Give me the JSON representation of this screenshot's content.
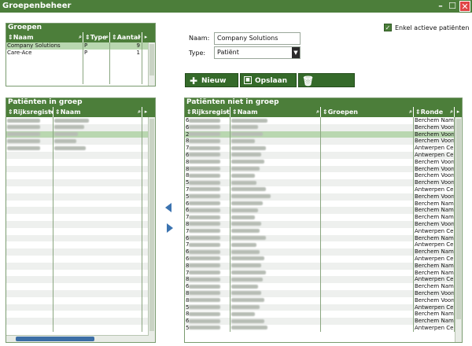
{
  "window": {
    "title": "Groepenbeheer",
    "min": "–",
    "max": "☐",
    "close": "✕"
  },
  "groups": {
    "title": "Groepen",
    "columns": [
      "Naam",
      "Type",
      "Aantal"
    ],
    "rows": [
      {
        "naam": "Company Solutions",
        "type": "P",
        "aantal": "9"
      },
      {
        "naam": "Care-Ace",
        "type": "P",
        "aantal": "1"
      }
    ]
  },
  "form": {
    "name_label": "Naam:",
    "name_value": "Company Solutions",
    "type_label": "Type:",
    "type_value": "Patiënt",
    "active_label": "Enkel actieve patiënten"
  },
  "toolbar": {
    "new_label": "Nieuw",
    "save_label": "Opslaan",
    "delete_label": "Verwijderen"
  },
  "in_group": {
    "title": "Patiënten in groep",
    "columns": [
      "Rijksregiste",
      "Naam"
    ],
    "selected_row": 2
  },
  "not_in_group": {
    "title": "Patiënten niet in groep",
    "columns": [
      "Rijksregiste",
      "Naam",
      "Groepen",
      "Ronde"
    ],
    "rondes": [
      "Berchem Nami",
      "Berchem Voorn",
      "Berchem Voorn",
      "Berchem Voorn",
      "Antwerpen Cer",
      "Antwerpen Cer",
      "Berchem Voorn",
      "Berchem Voorn",
      "Berchem Voorn",
      "Berchem Voorn",
      "Antwerpen Cer",
      "Berchem Voorn",
      "Berchem Nami",
      "Berchem Nami",
      "Berchem Nami",
      "Berchem Voorn",
      "Antwerpen Cer",
      "Berchem Nami",
      "Antwerpen Cer",
      "Berchem Nami",
      "Antwerpen Cer",
      "Berchem Nami",
      "Berchem Nami",
      "Antwerpen Cer",
      "Berchem Nami",
      "Berchem Voorn",
      "Berchem Voorn",
      "Antwerpen Cer",
      "Berchem Nami",
      "Berchem Nami",
      "Antwerpen Cer"
    ],
    "rijks_prefix": [
      "6",
      "6",
      "2",
      "8",
      "7",
      "6",
      "8",
      "8",
      "8",
      "5",
      "7",
      "5",
      "6",
      "6",
      "7",
      "8",
      "7",
      "6",
      "7",
      "6",
      "6",
      "8",
      "7",
      "8",
      "6",
      "8",
      "8",
      "5",
      "8",
      "6",
      "5"
    ],
    "selected_row": 2
  }
}
